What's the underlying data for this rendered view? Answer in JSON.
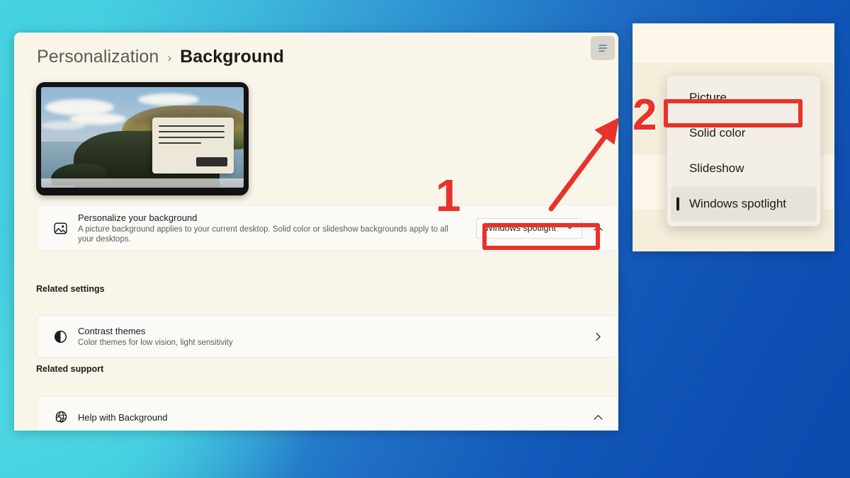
{
  "desktop": {
    "gradient_from": "#45d3e0",
    "gradient_to": "#0b4bae"
  },
  "settings_window": {
    "breadcrumb": {
      "root": "Personalization",
      "separator": "›",
      "current": "Background"
    },
    "topright_button": "more-options",
    "preview": {
      "name": "desktop-background-preview"
    },
    "personalize_row": {
      "icon": "image-icon",
      "title": "Personalize your background",
      "description": "A picture background applies to your current desktop. Solid color or slideshow backgrounds apply to all your desktops.",
      "dropdown_value": "Windows spotlight",
      "dropdown_chevron": "⌄",
      "expander": "chevron-up"
    },
    "related_settings": {
      "heading": "Related settings",
      "items": [
        {
          "icon": "contrast-icon",
          "title": "Contrast themes",
          "description": "Color themes for low vision, light sensitivity",
          "chevron": "›"
        }
      ]
    },
    "related_support": {
      "heading": "Related support",
      "items": [
        {
          "icon": "globe-search-icon",
          "title": "Help with Background",
          "chevron": "chevron-up"
        }
      ]
    }
  },
  "flyout": {
    "menu": {
      "name": "background-type-dropdown",
      "options": [
        {
          "label": "Picture",
          "selected": false,
          "highlighted": false
        },
        {
          "label": "Solid color",
          "selected": false,
          "highlighted": true
        },
        {
          "label": "Slideshow",
          "selected": false,
          "highlighted": false
        },
        {
          "label": "Windows spotlight",
          "selected": true,
          "highlighted": false
        }
      ]
    }
  },
  "annotations": {
    "accent_color": "#e8322a",
    "step_one": "1",
    "step_two": "2",
    "arrow": "arrow-up-right"
  }
}
